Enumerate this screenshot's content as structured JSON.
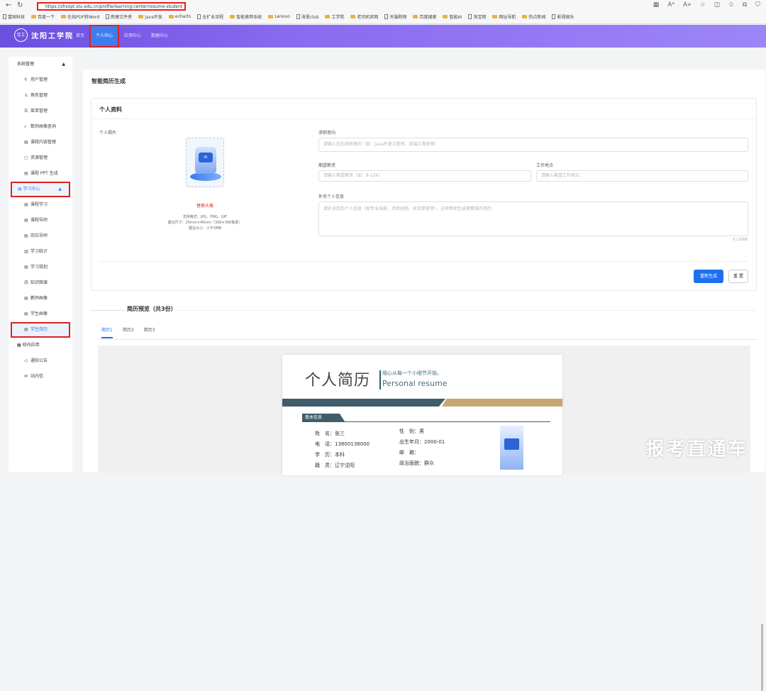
{
  "browser": {
    "url": "https://zhsxpt.stu.edu.cn/profile/learning-center/resume-student",
    "bookmarks": [
      "富国科技",
      "百度一下",
      "在线PDF转Word",
      "新建文件夹",
      "java开发",
      "echarts",
      "全扩业流程",
      "智能推荐系统",
      "Lenovo",
      "海里club",
      "工学院",
      "老司机官网",
      "天猫购物",
      "百度搜索",
      "智能AI",
      "淘宝网",
      "网址导航",
      "热点新闻",
      "影视娱乐"
    ]
  },
  "header": {
    "logo_badge": "沈工",
    "logo_text": "沈阳工学院",
    "nav": [
      {
        "label": "首页"
      },
      {
        "label": "个人中心"
      },
      {
        "label": "应用中心"
      },
      {
        "label": "数据中心"
      }
    ]
  },
  "sidebar": {
    "group1": "系统管理",
    "group1_items": [
      "用户管理",
      "角色管理",
      "菜单管理",
      "数师画像查询",
      "课程内容管理",
      "资源管理",
      "课程 PPT 生成"
    ],
    "group2": "学习中心",
    "group2_items": [
      "课程学习",
      "课程导师",
      "岗位导师",
      "学习统计",
      "学习规划",
      "知识图谱",
      "教师画像",
      "学生画像",
      "学生简历"
    ],
    "group3": "校内应用",
    "group3_items": [
      "通知公告",
      "站内信"
    ]
  },
  "main": {
    "title": "智能简历生成",
    "card_title": "个人资料",
    "photo_label": "个人照片",
    "photo_link": "替换头像",
    "photo_hint1": "支持格式：JPG、PNG、GIF",
    "photo_hint2": "建议尺寸：25mm×45mm（300×390像素）",
    "photo_hint3": "建议大小：小于2MB",
    "job_label": "求职意向",
    "job_placeholder": "请输入您的求职意向（如：Java开发工程师、前端工程师等）",
    "salary_label": "期望薪资",
    "salary_placeholder": "请输入期望薪资（如：8-12k）",
    "location_label": "工作地点",
    "location_placeholder": "请输入期望工作地点",
    "extra_label": "补充个人信息",
    "extra_placeholder": "请补充您的个人信息（如专业技能、项目经验、获奖荣誉等），这将帮助生成更精准的简历",
    "counter": "0 / 2000",
    "regen_btn": "重新生成",
    "reset_btn": "重 置",
    "preview_title": "简历预览（共3份）",
    "tabs": [
      "简历1",
      "简历2",
      "简历3"
    ]
  },
  "resume": {
    "title": "个人简历",
    "slogan": "细心从每一个小细节开始。",
    "en_title": "Personal resume",
    "section": "基本信息",
    "fields_left": [
      "姓　名：张三",
      "电　话：13800138000",
      "学　历：本科",
      "籍　贯：辽宁沈阳"
    ],
    "fields_right": [
      "性　别：男",
      "出生年月：2000-01",
      "邮　箱：",
      "政治面貌：群众"
    ]
  },
  "watermark": "报考直通车",
  "colors": {
    "accent": "#1e6ff0",
    "header": "#7b5cec",
    "highlight": "#e02020"
  }
}
